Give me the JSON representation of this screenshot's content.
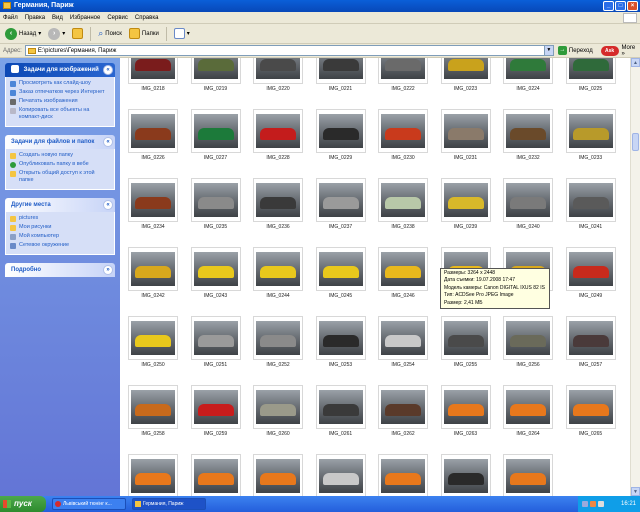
{
  "window": {
    "title": "Германия, Париж"
  },
  "menu": [
    "Файл",
    "Правка",
    "Вид",
    "Избранное",
    "Сервис",
    "Справка"
  ],
  "toolbar": {
    "back": "Назад",
    "search": "Поиск",
    "folders": "Папки"
  },
  "address": {
    "label": "Адрес:",
    "path": "E:\\pictures\\Германия, Париж",
    "go": "Переход",
    "ask": "Ask",
    "more": "More »"
  },
  "sidebar": {
    "image_tasks": {
      "title": "Задачи для изображений",
      "items": [
        "Просмотреть как слайд-шоу",
        "Заказ отпечатков через Интернет",
        "Печатать изображения",
        "Копировать все объекты на компакт-диск"
      ]
    },
    "file_tasks": {
      "title": "Задачи для файлов и папок",
      "items": [
        "Создать новую папку",
        "Опубликовать папку в вебе",
        "Открыть общий доступ к этой папке"
      ]
    },
    "other_places": {
      "title": "Другие места",
      "items": [
        "pictures",
        "Мои рисунки",
        "Мой компьютер",
        "Сетевое окружение"
      ]
    },
    "details": {
      "title": "Подробно"
    }
  },
  "thumbnails": [
    {
      "name": "IMG_0218",
      "car": "#7a1c1c"
    },
    {
      "name": "IMG_0219",
      "car": "#5a6b3a"
    },
    {
      "name": "IMG_0220",
      "car": "#4a4a4a"
    },
    {
      "name": "IMG_0221",
      "car": "#3a3a3a"
    },
    {
      "name": "IMG_0222",
      "car": "#6a6a6a"
    },
    {
      "name": "IMG_0223",
      "car": "#c9a21c"
    },
    {
      "name": "IMG_0224",
      "car": "#2f7a3a"
    },
    {
      "name": "IMG_0225",
      "car": "#2f6a3a"
    },
    {
      "name": "IMG_0226",
      "car": "#8a3a1c"
    },
    {
      "name": "IMG_0227",
      "car": "#1c7a3a"
    },
    {
      "name": "IMG_0228",
      "car": "#c41c1c"
    },
    {
      "name": "IMG_0229",
      "car": "#2a2a2a"
    },
    {
      "name": "IMG_0230",
      "car": "#c93a1c"
    },
    {
      "name": "IMG_0231",
      "car": "#8a7a6a"
    },
    {
      "name": "IMG_0232",
      "car": "#6a4a2a"
    },
    {
      "name": "IMG_0233",
      "car": "#b89a2a"
    },
    {
      "name": "IMG_0234",
      "car": "#8a3a1c"
    },
    {
      "name": "IMG_0235",
      "car": "#8a8a8a"
    },
    {
      "name": "IMG_0236",
      "car": "#3a3a3a"
    },
    {
      "name": "IMG_0237",
      "car": "#9a9a9a"
    },
    {
      "name": "IMG_0238",
      "car": "#b8c8a8"
    },
    {
      "name": "IMG_0239",
      "car": "#d8b82a"
    },
    {
      "name": "IMG_0240",
      "car": "#7a7a7a"
    },
    {
      "name": "IMG_0241",
      "car": "#5a5a5a"
    },
    {
      "name": "IMG_0242",
      "car": "#d8a81c"
    },
    {
      "name": "IMG_0243",
      "car": "#e8c81c"
    },
    {
      "name": "IMG_0244",
      "car": "#e8c81c"
    },
    {
      "name": "IMG_0245",
      "car": "#e8c81c"
    },
    {
      "name": "IMG_0246",
      "car": "#e8b81c"
    },
    {
      "name": "IMG_0247",
      "car": "#e8b81c"
    },
    {
      "name": "IMG_0248",
      "car": "#d8a81c"
    },
    {
      "name": "IMG_0249",
      "car": "#c82a1c"
    },
    {
      "name": "IMG_0250",
      "car": "#e8c81c"
    },
    {
      "name": "IMG_0251",
      "car": "#9a9a9a"
    },
    {
      "name": "IMG_0252",
      "car": "#8a8a8a"
    },
    {
      "name": "IMG_0253",
      "car": "#2a2a2a"
    },
    {
      "name": "IMG_0254",
      "car": "#c8c8c8"
    },
    {
      "name": "IMG_0255",
      "car": "#4a4a4a"
    },
    {
      "name": "IMG_0256",
      "car": "#6a6a5a"
    },
    {
      "name": "IMG_0257",
      "car": "#4a3a3a"
    },
    {
      "name": "IMG_0258",
      "car": "#c86a1c"
    },
    {
      "name": "IMG_0259",
      "car": "#c81c1c"
    },
    {
      "name": "IMG_0260",
      "car": "#9a9a8a"
    },
    {
      "name": "IMG_0261",
      "car": "#3a3a3a"
    },
    {
      "name": "IMG_0262",
      "car": "#5a3a2a"
    },
    {
      "name": "IMG_0263",
      "car": "#e8781c"
    },
    {
      "name": "IMG_0264",
      "car": "#e8781c"
    },
    {
      "name": "IMG_0265",
      "car": "#e8781c"
    },
    {
      "name": "",
      "car": "#e8781c"
    },
    {
      "name": "",
      "car": "#e8781c"
    },
    {
      "name": "",
      "car": "#e8781c"
    },
    {
      "name": "",
      "car": "#c8c8c8"
    },
    {
      "name": "",
      "car": "#e8781c"
    },
    {
      "name": "",
      "car": "#2a2a2a"
    },
    {
      "name": "",
      "car": "#e8781c"
    }
  ],
  "tooltip": [
    "Размеры: 3264 x 2448",
    "Дата съемки: 19.07.2008 17:47",
    "Модель камеры: Canon DIGITAL IXUS 82 IS",
    "Тип: ACDSee Pro JPEG Image",
    "Размер: 2,41 МБ"
  ],
  "taskbar": {
    "start": "пуск",
    "tasks": [
      "Львівський тюнінг к...",
      "Германия, Париж"
    ],
    "clock": "16:21"
  }
}
